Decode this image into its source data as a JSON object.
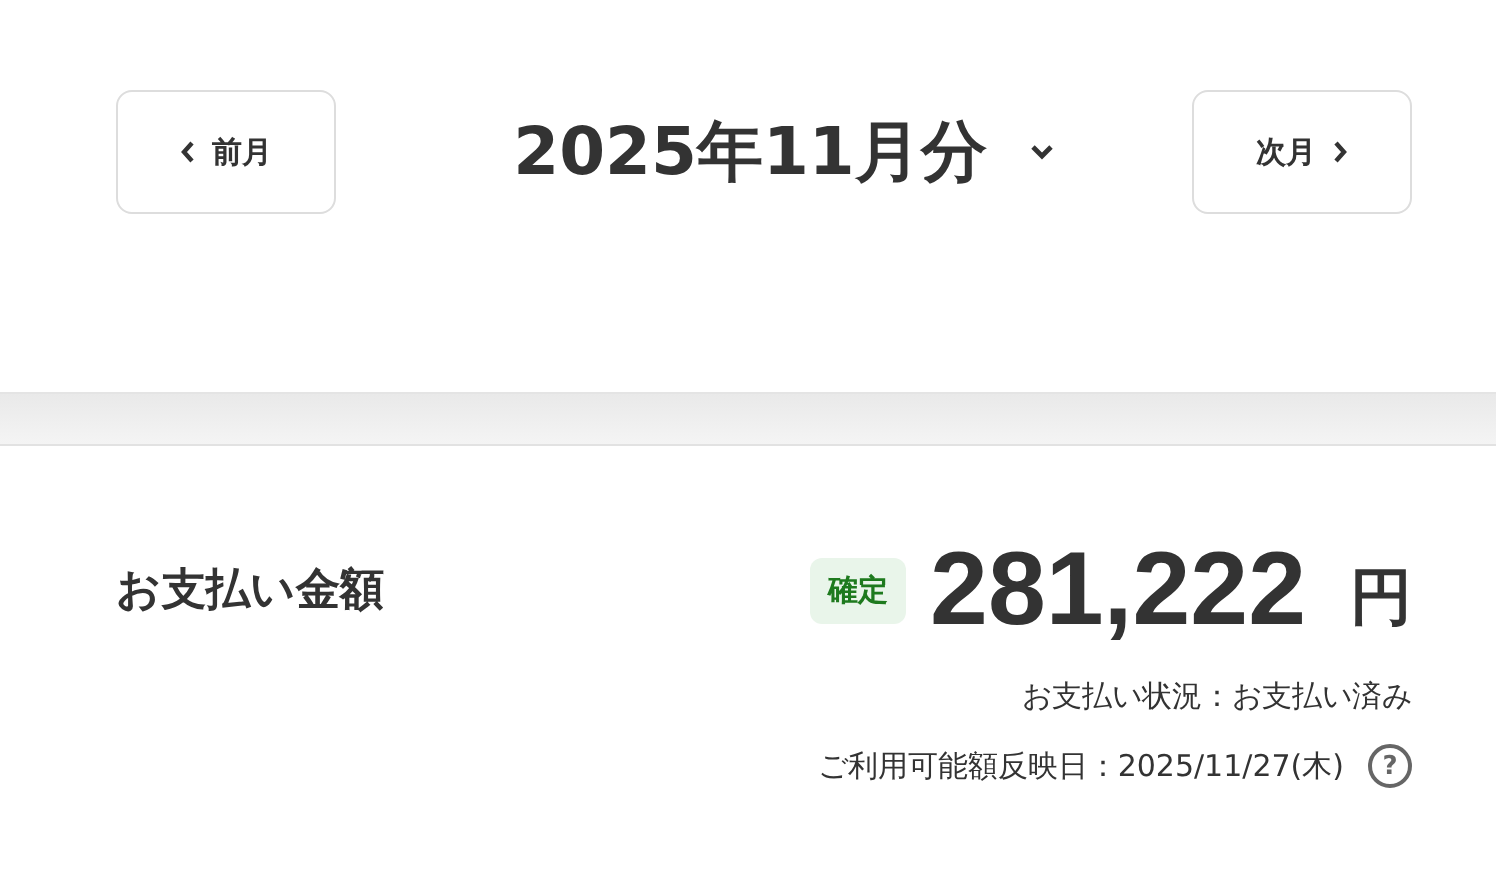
{
  "month_nav": {
    "prev_label": "前月",
    "title": "2025年11月分",
    "next_label": "次月"
  },
  "payment": {
    "label": "お支払い金額",
    "badge": "確定",
    "amount": "281,222",
    "unit": "円",
    "status": "お支払い状況：お支払い済み",
    "reflect_date": "ご利用可能額反映日：2025/11/27(木)",
    "help": "?"
  }
}
